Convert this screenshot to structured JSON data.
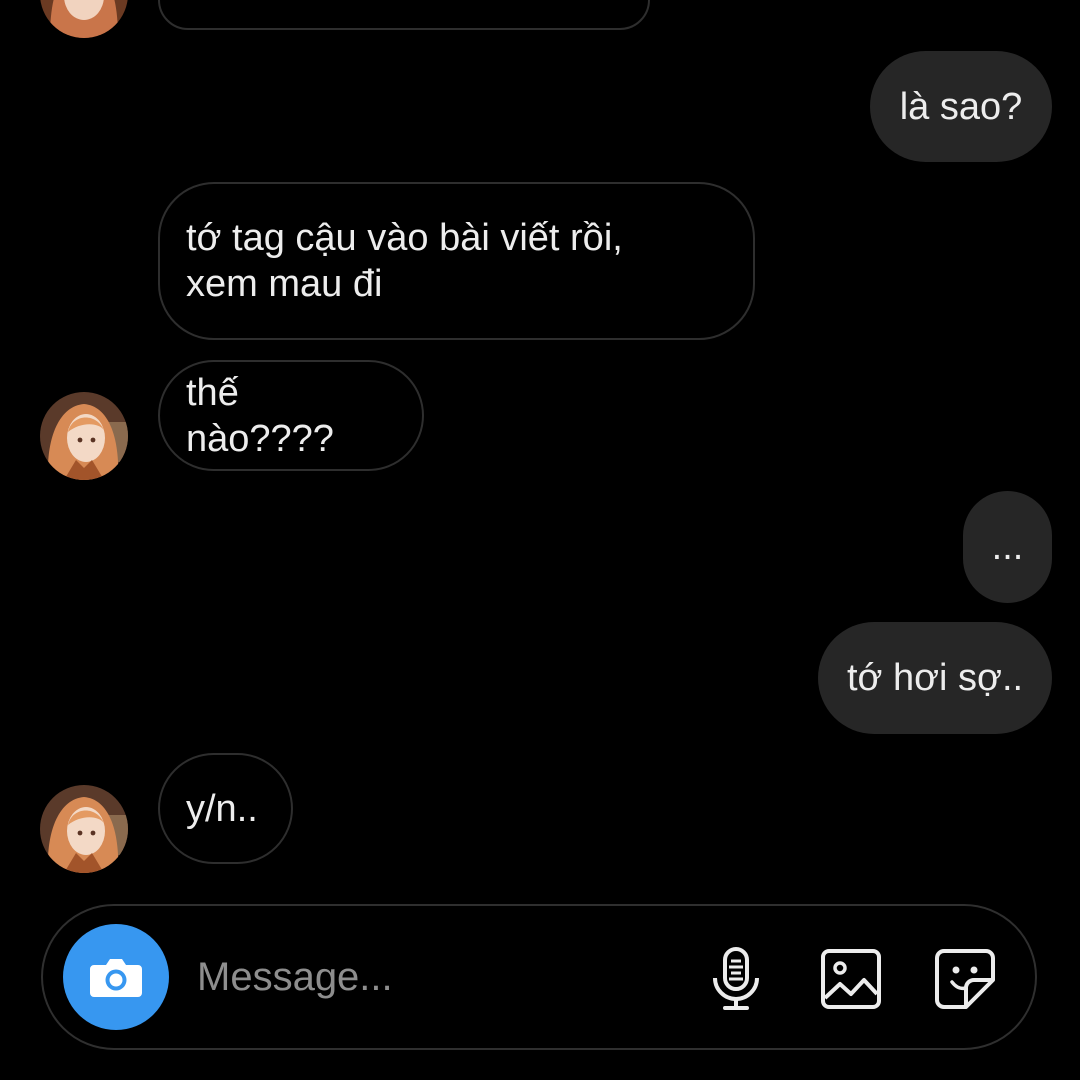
{
  "messages": [
    {
      "sender": "them",
      "text": ""
    },
    {
      "sender": "me",
      "text": "là sao?"
    },
    {
      "sender": "them",
      "text": "tớ tag cậu vào bài viết rồi,\nxem mau đi"
    },
    {
      "sender": "them",
      "text": "thế nào????"
    },
    {
      "sender": "me",
      "text": "..."
    },
    {
      "sender": "me",
      "text": "tớ hơi sợ.."
    },
    {
      "sender": "them",
      "text": "y/n.."
    }
  ],
  "composer": {
    "placeholder": "Message...",
    "value": ""
  },
  "icons": {
    "camera": "camera-icon",
    "microphone": "microphone-icon",
    "gallery": "gallery-icon",
    "sticker": "sticker-icon"
  },
  "colors": {
    "background": "#000000",
    "outgoing_bubble": "#262626",
    "incoming_border": "#2e2e2e",
    "camera_button": "#3797f0"
  }
}
